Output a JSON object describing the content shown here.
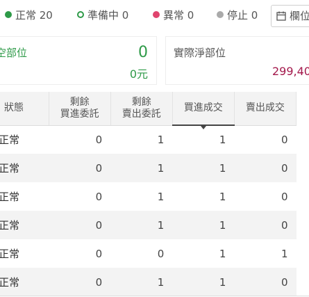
{
  "status_bar": {
    "items": [
      {
        "label": "正常 20",
        "color": "#2e9a48",
        "style": "filled"
      },
      {
        "label": "準備中 0",
        "color": "#2e9a48",
        "style": "hollow"
      },
      {
        "label": "異常 0",
        "color": "#e0446e",
        "style": "filled"
      },
      {
        "label": "停止 0",
        "color": "#aaaaaa",
        "style": "filled"
      }
    ],
    "columns_button": {
      "label": "欄位",
      "icon": "calendar-icon"
    }
  },
  "summary": {
    "left": {
      "title": "空部位",
      "quantity": "0",
      "amount": "0元",
      "color": "#2e9a48"
    },
    "right": {
      "title": "實際淨部位",
      "amount": "299,40",
      "color": "#a3184b"
    }
  },
  "table": {
    "headers": [
      {
        "line1": "狀態",
        "line2": ""
      },
      {
        "line1": "剩餘",
        "line2": "買進委託"
      },
      {
        "line1": "剩餘",
        "line2": "賣出委託"
      },
      {
        "line1": "買進成交",
        "line2": "",
        "sorted": true
      },
      {
        "line1": "賣出成交",
        "line2": ""
      }
    ],
    "rows": [
      [
        "正常",
        "0",
        "1",
        "1",
        "0"
      ],
      [
        "正常",
        "0",
        "1",
        "1",
        "0"
      ],
      [
        "正常",
        "0",
        "1",
        "1",
        "0"
      ],
      [
        "正常",
        "0",
        "1",
        "1",
        "0"
      ],
      [
        "正常",
        "0",
        "0",
        "1",
        "1"
      ],
      [
        "正常",
        "0",
        "1",
        "1",
        "0"
      ]
    ]
  }
}
